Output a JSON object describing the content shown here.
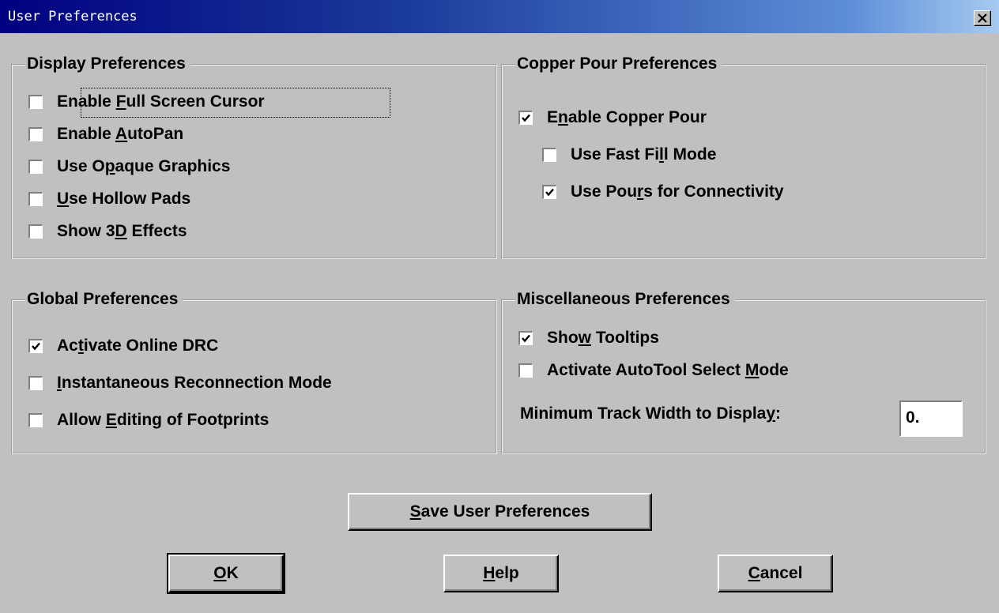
{
  "window": {
    "title": "User Preferences",
    "close_glyph": "close-icon"
  },
  "display": {
    "title": "Display Preferences",
    "items": [
      {
        "pre": "Enable ",
        "ul": "F",
        "post": "ull Screen Cursor",
        "checked": false
      },
      {
        "pre": "Enable ",
        "ul": "A",
        "post": "utoPan",
        "checked": false
      },
      {
        "pre": "Use O",
        "ul": "p",
        "post": "aque Graphics",
        "checked": false
      },
      {
        "pre": "",
        "ul": "U",
        "post": "se Hollow Pads",
        "checked": false
      },
      {
        "pre": "Show 3",
        "ul": "D",
        "post": " Effects",
        "checked": false
      }
    ]
  },
  "copper": {
    "title": "Copper Pour Preferences",
    "items": [
      {
        "pre": "E",
        "ul": "n",
        "post": "able Copper Pour",
        "checked": true
      },
      {
        "pre": "Use Fast Fi",
        "ul": "l",
        "post": "l Mode",
        "checked": false
      },
      {
        "pre": "Use Pou",
        "ul": "r",
        "post": "s for Connectivity",
        "checked": true
      }
    ]
  },
  "global": {
    "title": "Global Preferences",
    "items": [
      {
        "pre": "Ac",
        "ul": "t",
        "post": "ivate Online DRC",
        "checked": true
      },
      {
        "pre": "",
        "ul": "I",
        "post": "nstantaneous Reconnection Mode",
        "checked": false
      },
      {
        "pre": "Allow ",
        "ul": "E",
        "post": "diting of Footprints",
        "checked": false
      }
    ]
  },
  "misc": {
    "title": "Miscellaneous Preferences",
    "items": [
      {
        "pre": "Sho",
        "ul": "w",
        "post": " Tooltips",
        "checked": true
      },
      {
        "pre": "Activate AutoTool Select ",
        "ul": "M",
        "post": "ode",
        "checked": false
      }
    ],
    "track_label": {
      "pre": "Minimum Track Width to Displa",
      "ul": "y",
      "post": ":"
    },
    "track_value": "0."
  },
  "buttons": {
    "save": {
      "ul": "S",
      "post": "ave User Preferences"
    },
    "ok": {
      "ul": "O",
      "post": "K"
    },
    "help": {
      "ul": "H",
      "post": "elp"
    },
    "cancel": {
      "ul": "C",
      "post": "ancel"
    }
  }
}
